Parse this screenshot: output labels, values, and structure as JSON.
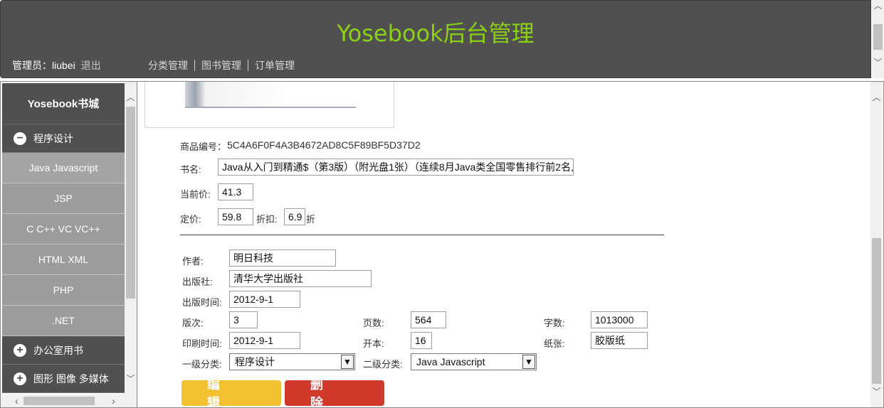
{
  "header": {
    "title": "Yosebook后台管理",
    "admin_label": "管理员：liubei",
    "logout": "退出",
    "nav": [
      "分类管理",
      "图书管理",
      "订单管理"
    ]
  },
  "sidebar": {
    "brand": "Yosebook书城",
    "categories": [
      {
        "label": "程序设计",
        "expanded": true,
        "icon": "minus-circle-icon",
        "items": [
          "Java Javascript",
          "JSP",
          "C C++ VC VC++",
          "HTML XML",
          "PHP",
          ".NET"
        ]
      },
      {
        "label": "办公室用书",
        "expanded": false,
        "icon": "plus-circle-icon"
      },
      {
        "label": "图形 图像 多媒体",
        "expanded": false,
        "icon": "plus-circle-icon"
      }
    ]
  },
  "book": {
    "id_label": "商品编号：",
    "id_value": "5C4A6F0F4A3B4672AD8C5F89BF5D37D2",
    "name_label": "书名:",
    "name_value": "Java从入门到精通$（第3版）（附光盘1张）（连续8月Java类全国零售排行前2名,",
    "current_price_label": "当前价:",
    "current_price": "41.3",
    "list_price_label": "定价:",
    "list_price": "59.8",
    "discount_label": "折扣:",
    "discount": "6.9",
    "discount_suffix": "折",
    "author_label": "作者:",
    "author": "明日科技",
    "publisher_label": "出版社:",
    "publisher": "清华大学出版社",
    "publish_date_label": "出版时间:",
    "publish_date": "2012-9-1",
    "edition_label": "版次:",
    "edition": "3",
    "pages_label": "页数:",
    "pages": "564",
    "words_label": "字数:",
    "words": "1013000",
    "print_date_label": "印刷时间:",
    "print_date": "2012-9-1",
    "format_label": "开本:",
    "format": "16",
    "paper_label": "纸张:",
    "paper": "胶版纸",
    "cat1_label": "一级分类:",
    "cat1": "程序设计",
    "cat2_label": "二级分类:",
    "cat2": "Java Javascript",
    "edit_button": "编辑",
    "delete_button": "删除"
  },
  "colors": {
    "accent_title": "#8ad014",
    "edit": "#f2c030",
    "delete": "#d13a2a",
    "dark": "#505050"
  }
}
